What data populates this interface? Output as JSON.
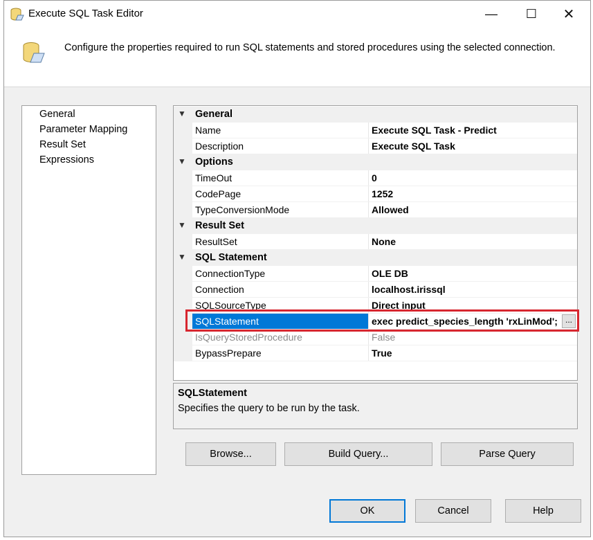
{
  "window": {
    "title": "Execute SQL Task Editor",
    "minimize_glyph": "—",
    "maximize_glyph": "☐",
    "close_glyph": "✕"
  },
  "header": {
    "description": "Configure the properties required to run SQL statements and stored procedures using the selected connection."
  },
  "nav": {
    "items": [
      {
        "label": "General"
      },
      {
        "label": "Parameter Mapping"
      },
      {
        "label": "Result Set"
      },
      {
        "label": "Expressions"
      }
    ]
  },
  "grid": {
    "categories": [
      {
        "label": "General",
        "properties": [
          {
            "name": "Name",
            "value": "Execute SQL Task  - Predict"
          },
          {
            "name": "Description",
            "value": "Execute SQL Task"
          }
        ]
      },
      {
        "label": "Options",
        "properties": [
          {
            "name": "TimeOut",
            "value": "0"
          },
          {
            "name": "CodePage",
            "value": "1252"
          },
          {
            "name": "TypeConversionMode",
            "value": "Allowed"
          }
        ]
      },
      {
        "label": "Result Set",
        "properties": [
          {
            "name": "ResultSet",
            "value": "None"
          }
        ]
      },
      {
        "label": "SQL Statement",
        "properties": [
          {
            "name": "ConnectionType",
            "value": "OLE DB"
          },
          {
            "name": "Connection",
            "value": "localhost.irissql"
          },
          {
            "name": "SQLSourceType",
            "value": "Direct input"
          },
          {
            "name": "SQLStatement",
            "value": "exec predict_species_length 'rxLinMod';"
          },
          {
            "name": "IsQueryStoredProcedure",
            "value": "False"
          },
          {
            "name": "BypassPrepare",
            "value": "True"
          }
        ]
      }
    ],
    "ellipsis_label": "..."
  },
  "description_panel": {
    "title": "SQLStatement",
    "text": "Specifies the query to be run by the task."
  },
  "buttons": {
    "browse": "Browse...",
    "build_query": "Build Query...",
    "parse_query": "Parse Query",
    "ok": "OK",
    "cancel": "Cancel",
    "help": "Help"
  },
  "colors": {
    "selection": "#0078d7",
    "highlight_border": "#d7262f",
    "dialog_background": "#f0f0f0"
  }
}
